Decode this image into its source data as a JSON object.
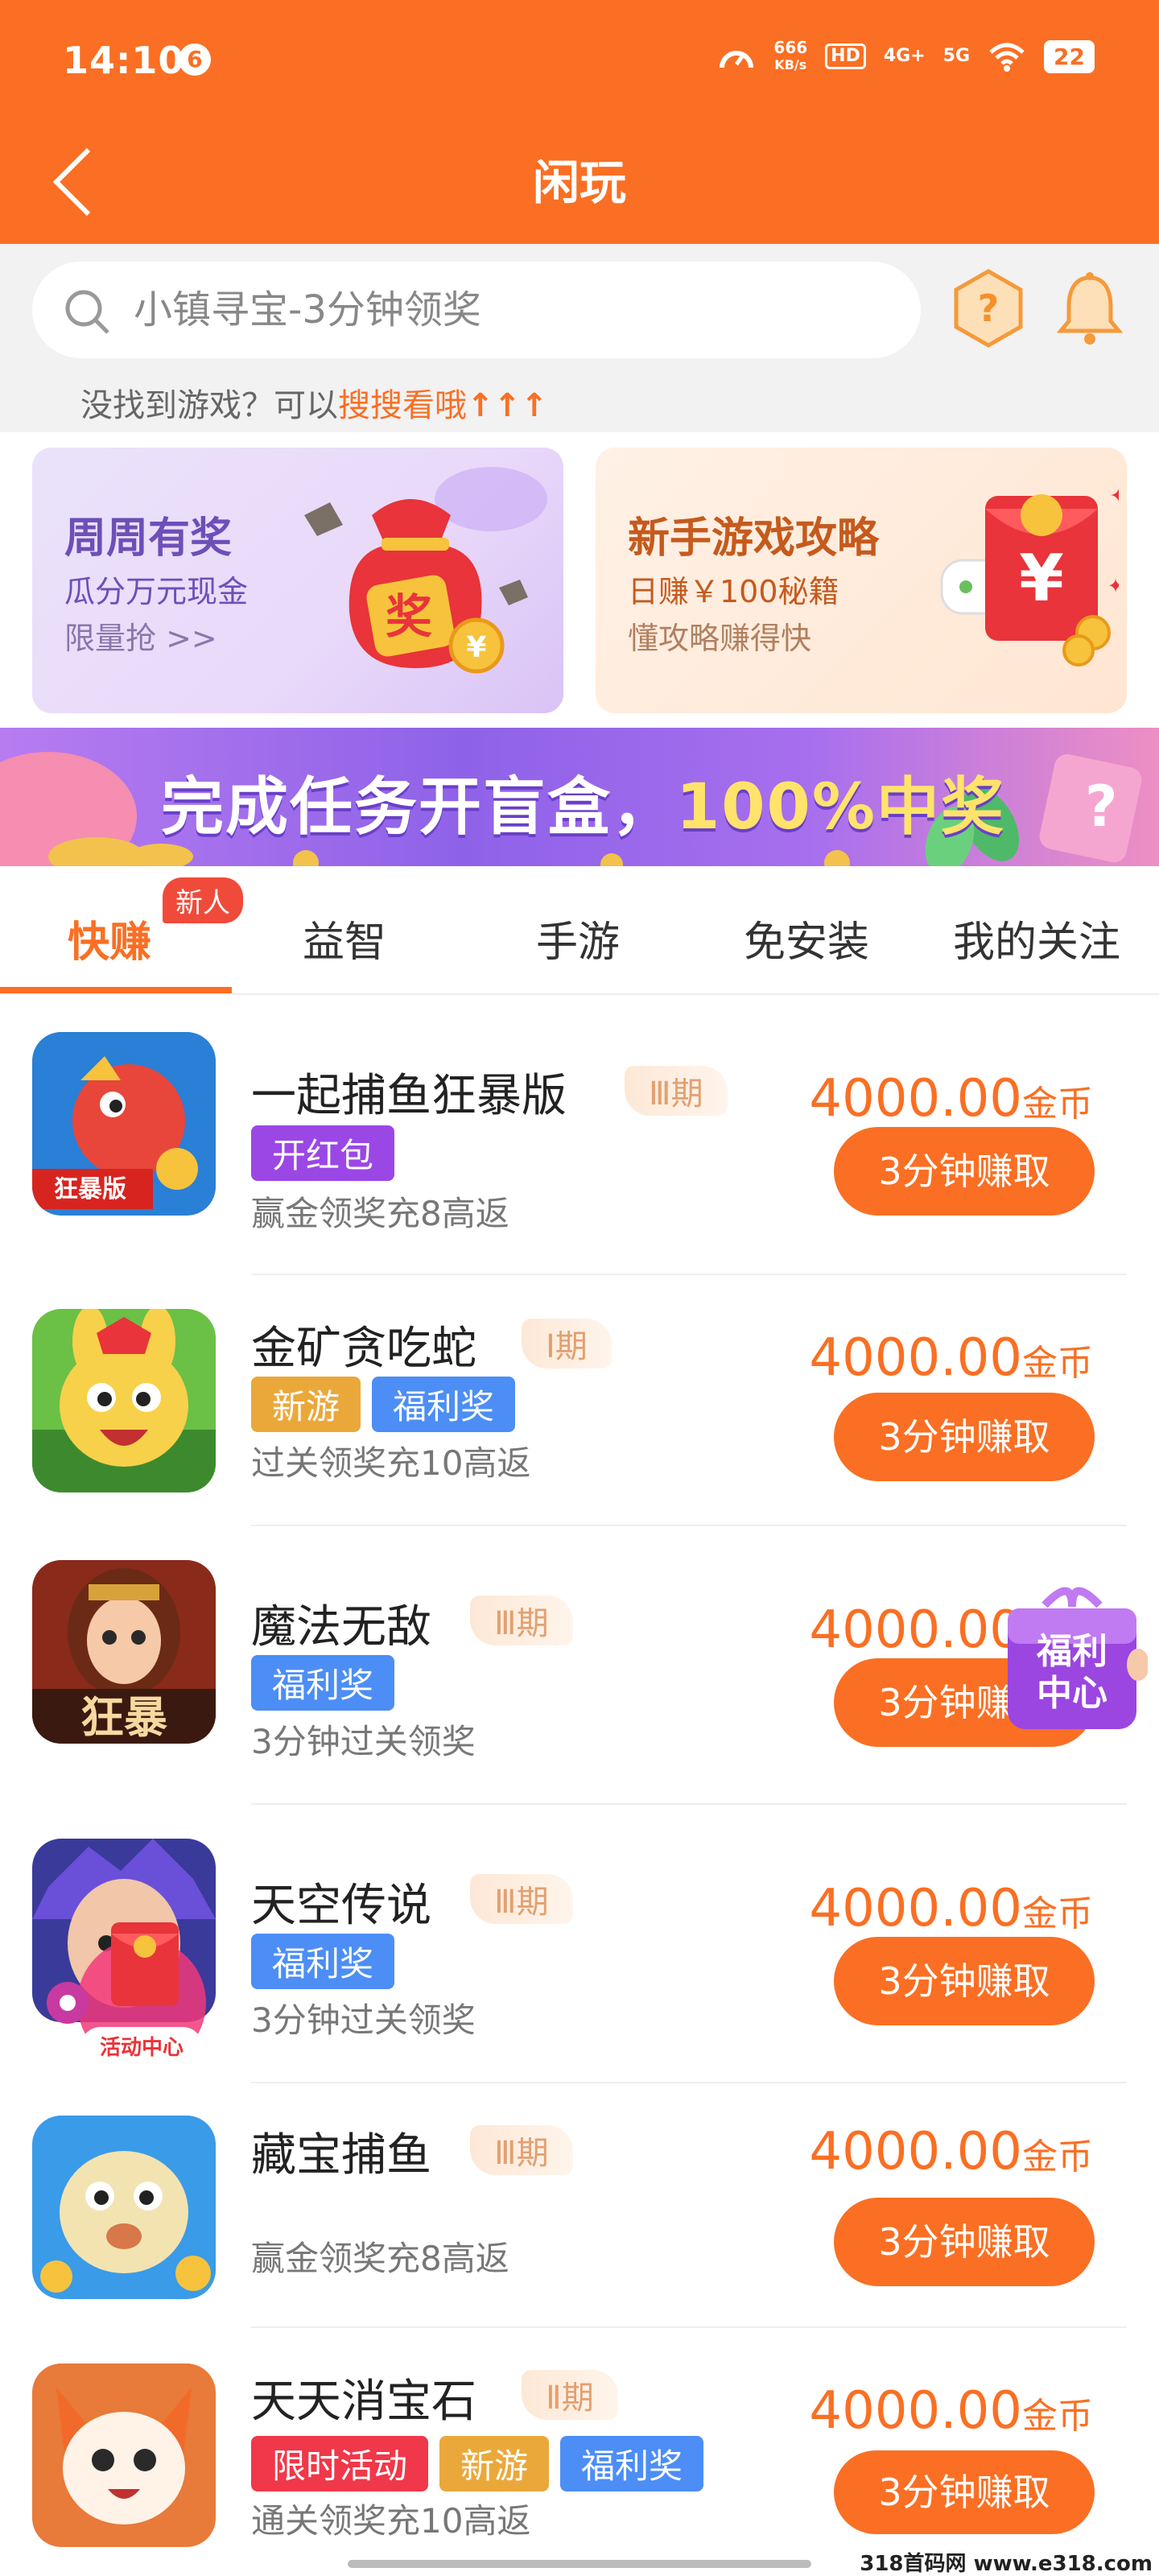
{
  "status_bar": {
    "time": "14:10",
    "notification_count": "6",
    "net_speed_value": "666",
    "net_speed_unit": "KB/s",
    "hd_label": "HD",
    "signal_4g": "4G+",
    "signal_5g": "5G",
    "battery": "22"
  },
  "header": {
    "title": "闲玩"
  },
  "search": {
    "placeholder": "小镇寻宝-3分钟领奖",
    "hint_prefix": "没找到游戏？可以",
    "hint_link": "搜搜看哦",
    "hint_arrows": "↑↑↑"
  },
  "promos": [
    {
      "title": "周周有奖",
      "subtitle": "瓜分万元现金",
      "more": "限量抢 >>",
      "bag_char": "奖"
    },
    {
      "title": "新手游戏攻略",
      "subtitle": "日赚￥100秘籍",
      "more": "懂攻略赚得快"
    }
  ],
  "banner": {
    "text_main": "完成任务开盲盒，",
    "text_highlight": "100%中奖"
  },
  "tabs": {
    "items": [
      "快赚",
      "益智",
      "手游",
      "免安装",
      "我的关注"
    ],
    "active_index": 0,
    "new_badge": "新人"
  },
  "reward_unit": "金币",
  "games": [
    {
      "name": "一起捕鱼狂暴版",
      "period": "Ⅲ期",
      "tags": [
        {
          "label": "开红包",
          "color": "purple"
        }
      ],
      "desc": "赢金领奖充8高返",
      "reward": "4000.00",
      "button": "3分钟赚取",
      "icon_text": "狂暴版"
    },
    {
      "name": "金矿贪吃蛇",
      "period": "Ⅰ期",
      "tags": [
        {
          "label": "新游",
          "color": "yellow"
        },
        {
          "label": "福利奖",
          "color": "blue"
        }
      ],
      "desc": "过关领奖充10高返",
      "reward": "4000.00",
      "button": "3分钟赚取",
      "icon_text": ""
    },
    {
      "name": "魔法无敌",
      "period": "Ⅲ期",
      "tags": [
        {
          "label": "福利奖",
          "color": "blue"
        }
      ],
      "desc": "3分钟过关领奖",
      "reward": "4000.00",
      "button": "3分钟赚取",
      "icon_text": "狂暴"
    },
    {
      "name": "天空传说",
      "period": "Ⅲ期",
      "tags": [
        {
          "label": "福利奖",
          "color": "blue"
        }
      ],
      "desc": "3分钟过关领奖",
      "reward": "4000.00",
      "button": "3分钟赚取",
      "icon_text": ""
    },
    {
      "name": "藏宝捕鱼",
      "period": "Ⅲ期",
      "tags": [],
      "desc": "赢金领奖充8高返",
      "reward": "4000.00",
      "button": "3分钟赚取",
      "icon_text": ""
    },
    {
      "name": "天天消宝石",
      "period": "Ⅱ期",
      "tags": [
        {
          "label": "限时活动",
          "color": "red"
        },
        {
          "label": "新游",
          "color": "yellow"
        },
        {
          "label": "福利奖",
          "color": "blue"
        }
      ],
      "desc": "通关领奖充10高返",
      "reward": "4000.00",
      "button": "3分钟赚取",
      "icon_text": ""
    }
  ],
  "floating": {
    "welfare_line1": "福利",
    "welfare_line2": "中心",
    "activity_label": "活动中心"
  },
  "watermark": "318首码网 www.e318.com"
}
